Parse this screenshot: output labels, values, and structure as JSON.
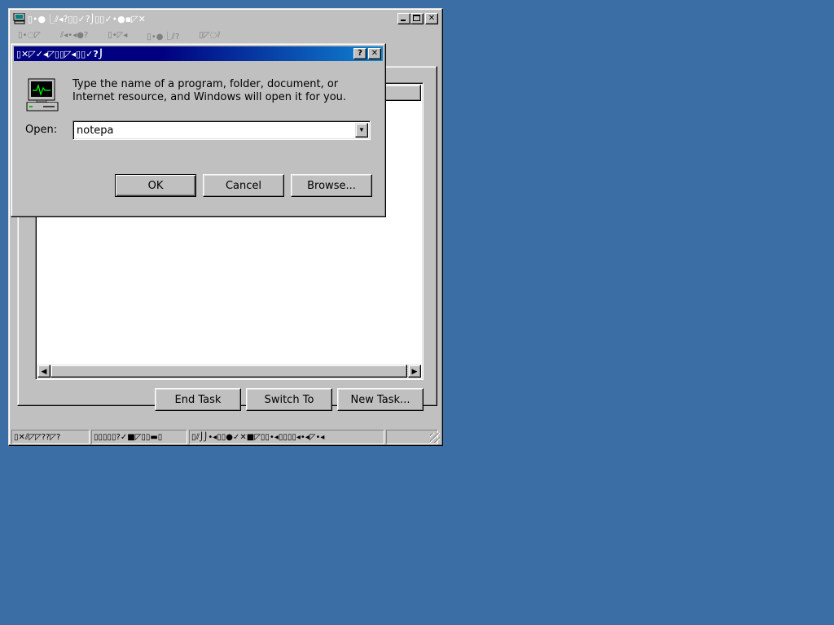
{
  "task_manager": {
    "title": "▯•●⎿⫽◂?▯▯✓?⌡▯▯✓•●▪◸✕",
    "menu": [
      "▯•◌◸",
      "⫽◂•◂●?",
      "▯•◸◂",
      "▯•●⎿⫽?",
      "▯◸◌⫽"
    ],
    "buttons": {
      "end_task": "End Task",
      "switch_to": "Switch To",
      "new_task": "New Task..."
    },
    "status": [
      "▯✕⫽◸◸??◸?",
      "▯▯▯▯▯?✓■◸▯▯▬▯",
      "▯⫽⌡⌡•◂▯▯●✓✕■◸▯▯•◂▯▯▯▯◂•◂◸•◂"
    ]
  },
  "run_dialog": {
    "title": "▯✕◸✓◂◸▯▯◸◂▯▯✓?⌡",
    "description_line1": "Type the name of a program, folder, document, or",
    "description_line2": "Internet resource, and Windows will open it for you.",
    "open_label": "Open:",
    "open_value": "notepa",
    "ok_label": "OK",
    "cancel_label": "Cancel",
    "browse_label": "Browse..."
  },
  "colors": {
    "desktop": "#3a6ea5",
    "face": "#c0c0c0",
    "active_title": "#000080"
  }
}
